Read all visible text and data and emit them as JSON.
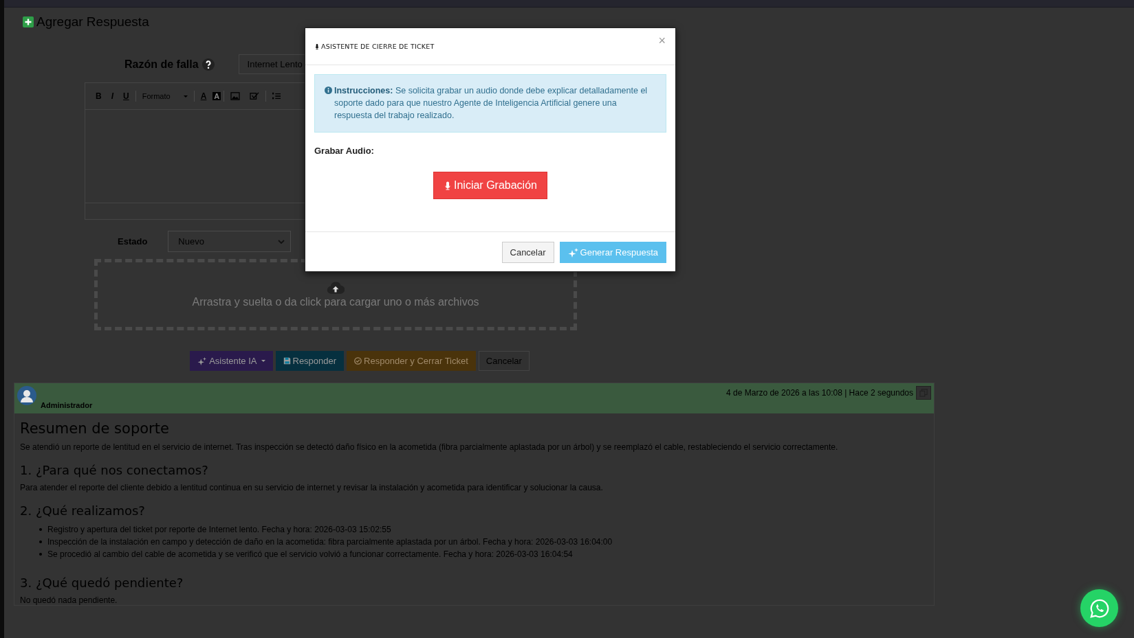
{
  "page_title": "Agregar Respuesta",
  "form": {
    "reason_label": "Razón de falla",
    "reason_value": "Internet Lento",
    "toolbar": [
      {
        "kind": "bold",
        "label": "B"
      },
      {
        "kind": "italic",
        "label": "I"
      },
      {
        "kind": "underline",
        "label": "U"
      },
      {
        "kind": "dropdown",
        "label": "Formato"
      },
      {
        "kind": "color",
        "label": "A"
      },
      {
        "kind": "highlight",
        "label": "A"
      },
      {
        "kind": "image"
      },
      {
        "kind": "check"
      },
      {
        "kind": "list"
      }
    ],
    "status_label": "Estado",
    "status_value": "Nuevo",
    "dropzone_text": "Arrastra y suelta o da click para cargar uno o más archivos"
  },
  "actions": [
    {
      "kind": "ai",
      "label": "Asistente IA"
    },
    {
      "kind": "save",
      "label": "Responder"
    },
    {
      "kind": "close",
      "label": "Responder y Cerrar Ticket"
    },
    {
      "kind": "cancel",
      "label": "Cancelar"
    }
  ],
  "comment": {
    "author": "Administrador",
    "timestamp": "4 de Marzo de 2026 a las 10:08 | Hace 2 segundos",
    "heading": "Resumen de soporte",
    "summary": "Se atendió un reporte de lentitud en el servicio de internet. Tras inspección se detectó daño físico en la acometida (fibra parcialmente aplastada por un árbol) y se reemplazó el cable, restableciendo el servicio correctamente.",
    "sections": [
      {
        "title": "1. ¿Para qué nos conectamos?",
        "paragraph": "Para atender el reporte del cliente debido a lentitud continua en su servicio de internet y revisar la instalación y acometida para identificar y solucionar la causa."
      },
      {
        "title": "2. ¿Qué realizamos?",
        "items": [
          "Registro y apertura del ticket por reporte de Internet lento. Fecha y hora: 2026-03-03 15:02:55",
          "Inspección de la instalación en campo y detección de daño en la acometida: fibra parcialmente aplastada por un árbol. Fecha y hora: 2026-03-03 16:04:00",
          "Se procedió al cambio del cable de acometida y se verificó que el servicio volvió a funcionar correctamente. Fecha y hora: 2026-03-03 16:04:54"
        ]
      },
      {
        "title": "3. ¿Qué quedó pendiente?",
        "paragraph": "No quedó nada pendiente."
      }
    ]
  },
  "modal": {
    "title": "ASISTENTE DE CIERRE DE TICKET",
    "close": "×",
    "alert": "**Instrucciones:** Se solicita grabar un audio donde debe explicar detalladamente el soporte dado para que nuestro Agente de Inteligencia Artificial genere una respuesta del trabajo realizado.",
    "record_label": "Grabar Audio:",
    "record_button": "Iniciar Grabación",
    "buttons": [
      {
        "kind": "cancel",
        "label": "Cancelar"
      },
      {
        "kind": "generate",
        "label": "Generar Respuesta"
      }
    ]
  }
}
